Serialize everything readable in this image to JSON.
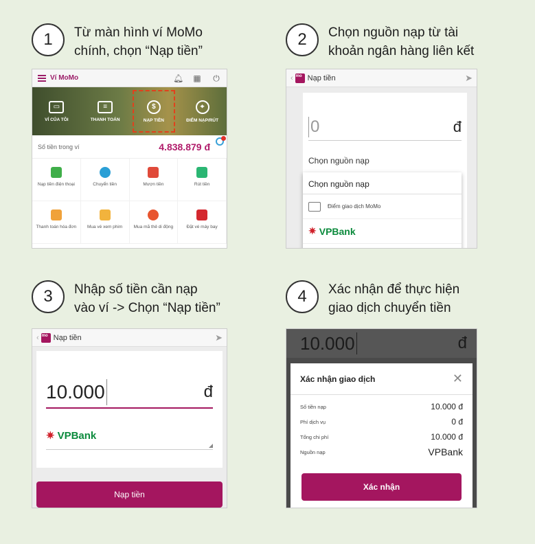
{
  "steps": [
    {
      "number": "1",
      "line1": "Từ màn hình ví MoMo",
      "line2": "chính, chọn “Nạp tiền”"
    },
    {
      "number": "2",
      "line1": "Chọn nguồn nạp từ tài",
      "line2": "khoản ngân hàng liên kết"
    },
    {
      "number": "3",
      "line1": "Nhập số tiền cần nạp",
      "line2": "vào ví -> Chọn “Nạp tiền”"
    },
    {
      "number": "4",
      "line1": "Xác nhận để thực hiện",
      "line2": "giao dịch chuyển tiền"
    }
  ],
  "screen1": {
    "app_title": "Ví MoMo",
    "tabs": [
      "VÍ CỦA TÔI",
      "THANH TOÁN",
      "NẠP TIỀN",
      "ĐIỂM NẠP/RÚT"
    ],
    "balance_label": "Số tiền trong ví",
    "balance_value": "4.838.879 đ",
    "grid": [
      "Nạp tiền điện thoại",
      "Chuyển tiền",
      "Mượn tiền",
      "Rút tiền",
      "Thanh toán hóa đơn",
      "Mua vé xem phim",
      "Mua mã thẻ di động",
      "Đặt vé máy bay"
    ],
    "grid_colors": [
      "#3fae49",
      "#2a9fd6",
      "#e04a3a",
      "#2bb673",
      "#f0a23a",
      "#f2b33d",
      "#e8552f",
      "#d4282f"
    ]
  },
  "screen2": {
    "title": "Nạp tiền",
    "amount": "0",
    "currency": "đ",
    "source_label": "Chọn nguồn nạp",
    "dropdown_header": "Chọn nguồn nạp",
    "option_store": "Điểm giao dịch MoMo",
    "option_bank": "VPBank"
  },
  "screen3": {
    "title": "Nạp tiền",
    "amount": "10.000",
    "currency": "đ",
    "bank": "VPBank",
    "button": "Nạp tiền"
  },
  "screen4": {
    "top_amount": "10.000",
    "currency": "đ",
    "dialog_title": "Xác nhận giao dịch",
    "rows": [
      {
        "label": "Số tiền nạp",
        "value": "10.000 đ"
      },
      {
        "label": "Phí dịch vụ",
        "value": "0 đ"
      },
      {
        "label": "Tổng chi phí",
        "value": "10.000 đ"
      },
      {
        "label": "Nguồn nạp",
        "value": "VPBank"
      }
    ],
    "button": "Xác nhận"
  },
  "colors": {
    "brand": "#a4165f",
    "background": "#e9f0e1",
    "balance": "#b01b6a",
    "vpbank_green": "#0b8a3c",
    "vpbank_red": "#d0202a"
  }
}
